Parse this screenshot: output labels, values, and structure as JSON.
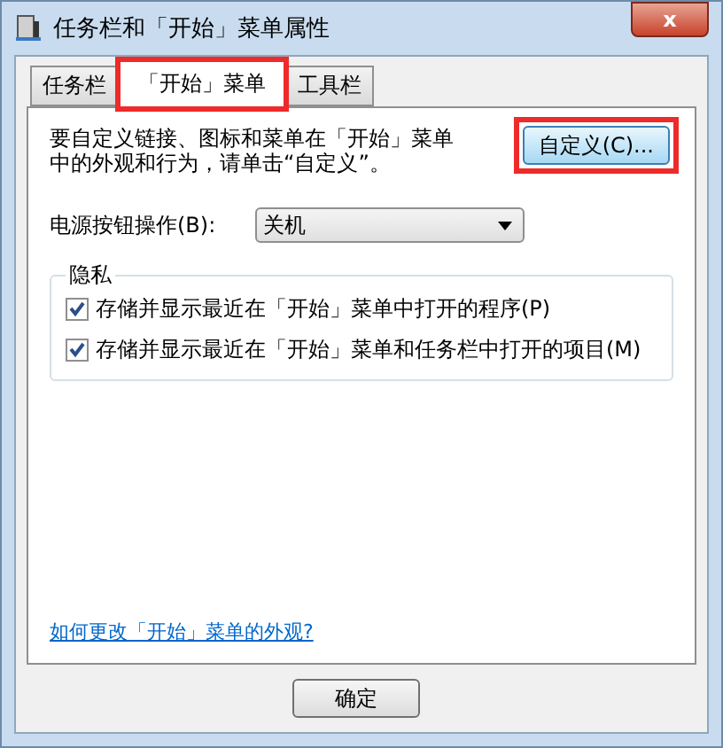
{
  "window": {
    "title": "任务栏和「开始」菜单属性",
    "close": "x"
  },
  "tabs": [
    {
      "label": "任务栏",
      "selected": false,
      "highlighted": false
    },
    {
      "label": "「开始」菜单",
      "selected": true,
      "highlighted": true
    },
    {
      "label": "工具栏",
      "selected": false,
      "highlighted": false
    }
  ],
  "description": "要自定义链接、图标和菜单在「开始」菜单中的外观和行为，请单击“自定义”。",
  "customize_button": {
    "label": "自定义(C)...",
    "highlighted": true
  },
  "power": {
    "label": "电源按钮操作(B):",
    "value": "关机"
  },
  "privacy": {
    "title": "隐私",
    "options": [
      {
        "label": "存储并显示最近在「开始」菜单中打开的程序(P)",
        "checked": true
      },
      {
        "label": "存储并显示最近在「开始」菜单和任务栏中打开的项目(M)",
        "checked": true
      }
    ]
  },
  "help_link": "如何更改「开始」菜单的外观?",
  "buttons": [
    "确定"
  ]
}
